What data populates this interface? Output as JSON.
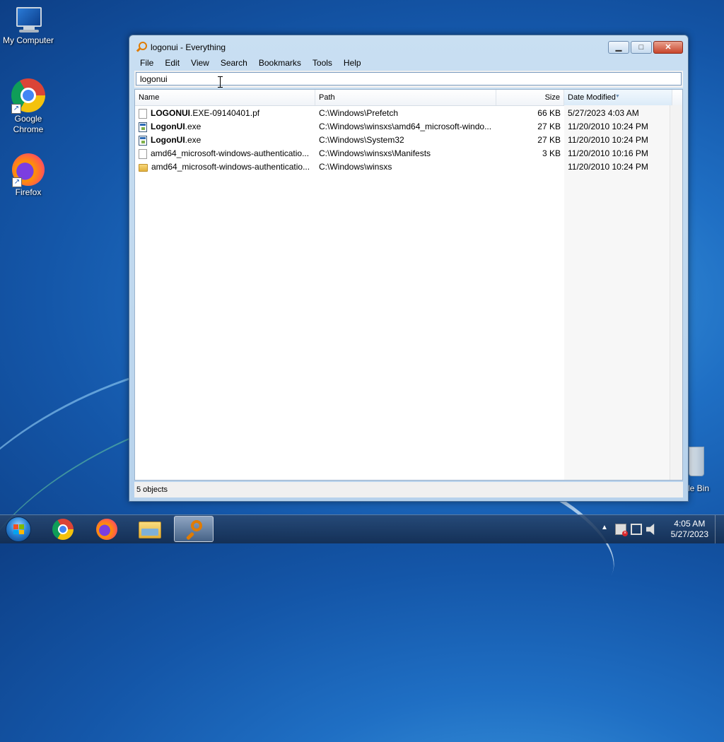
{
  "desktop": {
    "icons": [
      {
        "label": "My Computer",
        "icon": "computer-icon"
      },
      {
        "label": "Google\nChrome",
        "icon": "chrome-icon"
      },
      {
        "label": "Firefox",
        "icon": "firefox-icon"
      },
      {
        "label": "le Bin",
        "icon": "recycle-bin-icon"
      }
    ]
  },
  "window": {
    "title": "logonui - Everything",
    "caption": {
      "minimize": "▁",
      "maximize": "□",
      "close": "✕"
    },
    "menu": [
      "File",
      "Edit",
      "View",
      "Search",
      "Bookmarks",
      "Tools",
      "Help"
    ],
    "search": {
      "value": "logonui",
      "placeholder": ""
    },
    "columns": [
      "Name",
      "Path",
      "Size",
      "Date Modified"
    ],
    "sorted_column": "Date Modified",
    "rows": [
      {
        "icon": "doc",
        "name_bold": "LOGONUI",
        "name_rest": ".EXE-09140401.pf",
        "path": "C:\\Windows\\Prefetch",
        "size": "66 KB",
        "date": "5/27/2023 4:03 AM"
      },
      {
        "icon": "exe",
        "name_bold": "LogonUI",
        "name_rest": ".exe",
        "path": "C:\\Windows\\winsxs\\amd64_microsoft-windo...",
        "size": "27 KB",
        "date": "11/20/2010 10:24 PM"
      },
      {
        "icon": "exe",
        "name_bold": "LogonUI",
        "name_rest": ".exe",
        "path": "C:\\Windows\\System32",
        "size": "27 KB",
        "date": "11/20/2010 10:24 PM"
      },
      {
        "icon": "doc",
        "name_bold": "",
        "name_rest": "amd64_microsoft-windows-authenticatio...",
        "path": "C:\\Windows\\winsxs\\Manifests",
        "size": "3 KB",
        "date": "11/20/2010 10:16 PM"
      },
      {
        "icon": "folder",
        "name_bold": "",
        "name_rest": "amd64_microsoft-windows-authenticatio...",
        "path": "C:\\Windows\\winsxs",
        "size": "",
        "date": "11/20/2010 10:24 PM"
      }
    ],
    "status": "5 objects"
  },
  "taskbar": {
    "apps": [
      {
        "name": "chrome",
        "active": false
      },
      {
        "name": "firefox",
        "active": false
      },
      {
        "name": "explorer",
        "active": false
      },
      {
        "name": "everything",
        "active": true
      }
    ],
    "clock": {
      "time": "4:05 AM",
      "date": "5/27/2023"
    },
    "tray_arrow": "▲"
  }
}
